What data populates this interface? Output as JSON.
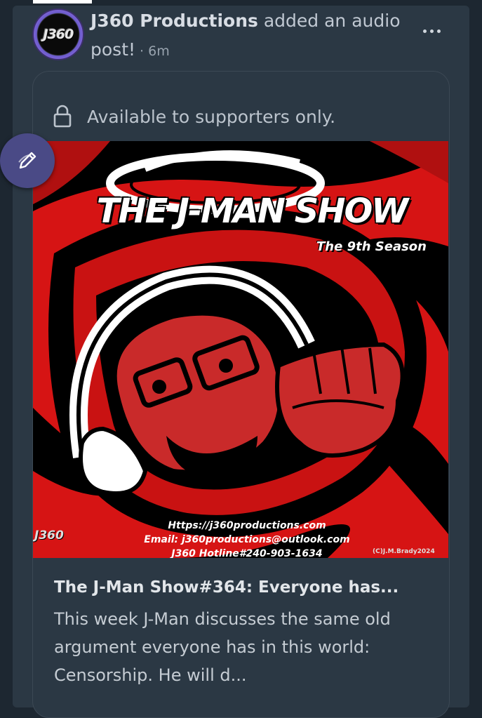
{
  "post": {
    "author": "J360 Productions",
    "action": " added an audio post!",
    "separator": " · ",
    "time": "6m",
    "avatar_text": "J360"
  },
  "lock": {
    "text": "Available to supporters only.",
    "icon": "lock-icon"
  },
  "cover": {
    "title": "THE J-MAN SHOW",
    "subtitle": "The 9th Season",
    "logo_text": "J360",
    "contact_line1": "Https://j360productions.com",
    "contact_line2": "Email: j360productions@outlook.com",
    "contact_line3": "J360 Hotline#240-903-1634",
    "copyright": "(C)J.M.Brady2024"
  },
  "episode": {
    "title": "The J-Man Show#364: Everyone has...",
    "description": "This week J-Man discusses the same old argument everyone has in this world: Censorship.  He will d..."
  },
  "icons": {
    "more": "more-options-icon",
    "compose": "compose-pencil-icon"
  },
  "colors": {
    "background": "#1d2731",
    "card": "#2b3844",
    "accent_fab": "#4a4a86",
    "cover_red": "#e01818"
  }
}
